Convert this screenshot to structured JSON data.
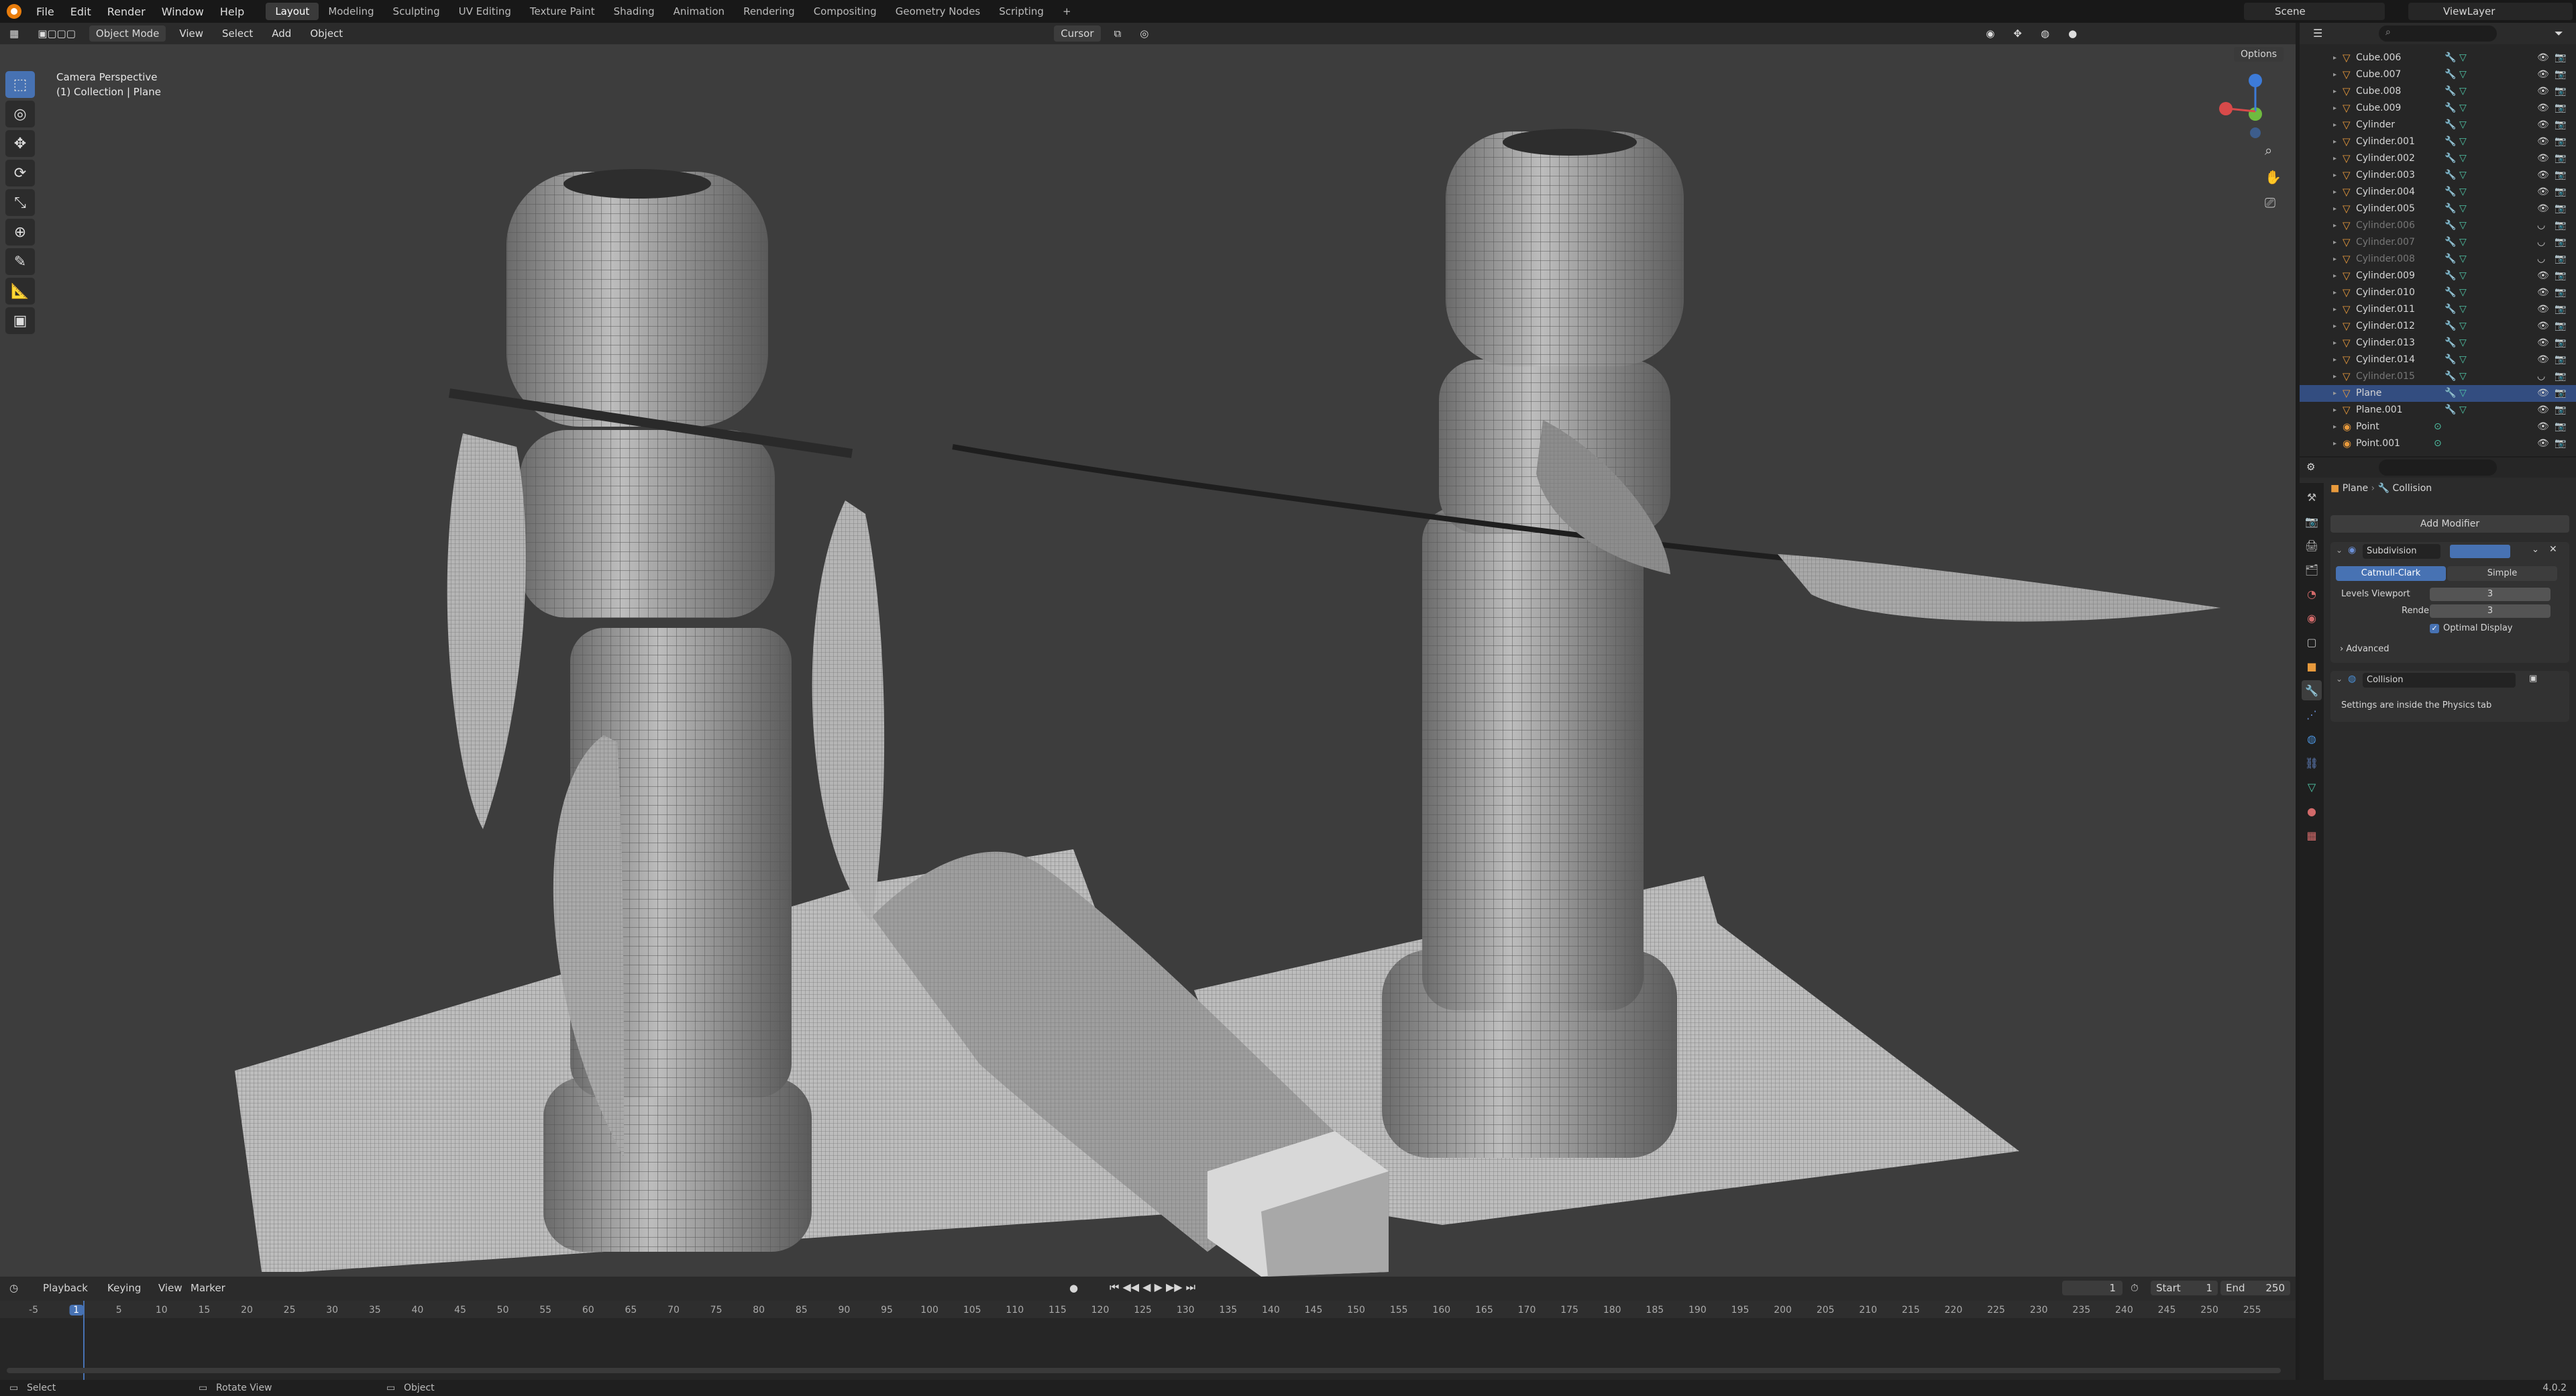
{
  "topbar": {
    "menus": [
      "File",
      "Edit",
      "Render",
      "Window",
      "Help"
    ],
    "workspaces": [
      "Layout",
      "Modeling",
      "Sculpting",
      "UV Editing",
      "Texture Paint",
      "Shading",
      "Animation",
      "Rendering",
      "Compositing",
      "Geometry Nodes",
      "Scripting",
      "+"
    ],
    "active_workspace": "Layout",
    "scene": "Scene",
    "view_layer": "ViewLayer"
  },
  "viewport_header": {
    "mode": "Object Mode",
    "menus": [
      "View",
      "Select",
      "Add",
      "Object"
    ],
    "transform_orientation": "Cursor",
    "options": "Options"
  },
  "viewport_info": {
    "line1": "Camera Perspective",
    "line2": "(1) Collection | Plane"
  },
  "outliner": {
    "rows": [
      {
        "name": "Cube.006",
        "state": "normal"
      },
      {
        "name": "Cube.007",
        "state": "normal"
      },
      {
        "name": "Cube.008",
        "state": "normal"
      },
      {
        "name": "Cube.009",
        "state": "normal"
      },
      {
        "name": "Cylinder",
        "state": "normal"
      },
      {
        "name": "Cylinder.001",
        "state": "normal"
      },
      {
        "name": "Cylinder.002",
        "state": "normal"
      },
      {
        "name": "Cylinder.003",
        "state": "normal"
      },
      {
        "name": "Cylinder.004",
        "state": "normal"
      },
      {
        "name": "Cylinder.005",
        "state": "normal"
      },
      {
        "name": "Cylinder.006",
        "state": "dim"
      },
      {
        "name": "Cylinder.007",
        "state": "dim"
      },
      {
        "name": "Cylinder.008",
        "state": "dim"
      },
      {
        "name": "Cylinder.009",
        "state": "normal"
      },
      {
        "name": "Cylinder.010",
        "state": "normal"
      },
      {
        "name": "Cylinder.011",
        "state": "normal"
      },
      {
        "name": "Cylinder.012",
        "state": "normal"
      },
      {
        "name": "Cylinder.013",
        "state": "normal"
      },
      {
        "name": "Cylinder.014",
        "state": "normal"
      },
      {
        "name": "Cylinder.015",
        "state": "dim"
      },
      {
        "name": "Plane",
        "state": "selected"
      },
      {
        "name": "Plane.001",
        "state": "normal"
      },
      {
        "name": "Point",
        "state": "light"
      },
      {
        "name": "Point.001",
        "state": "light"
      }
    ]
  },
  "properties": {
    "breadcrumb_object": "Plane",
    "breadcrumb_modifier": "Collision",
    "add_modifier": "Add Modifier",
    "subdivision": {
      "name": "Subdivision",
      "mode_a": "Catmull-Clark",
      "mode_b": "Simple",
      "levels_viewport_label": "Levels Viewport",
      "levels_viewport": "3",
      "render_label": "Render",
      "render": "3",
      "optimal_display": "Optimal Display",
      "advanced": "Advanced"
    },
    "collision": {
      "name": "Collision",
      "note": "Settings are inside the Physics tab"
    }
  },
  "timeline": {
    "menus": [
      "Playback",
      "Keying",
      "View",
      "Marker"
    ],
    "current_frame": "1",
    "start_label": "Start",
    "start": "1",
    "end_label": "End",
    "end": "250",
    "ticks": [
      "-5",
      "1",
      "5",
      "10",
      "15",
      "20",
      "25",
      "30",
      "35",
      "40",
      "45",
      "50",
      "55",
      "60",
      "65",
      "70",
      "75",
      "80",
      "85",
      "90",
      "95",
      "100",
      "105",
      "110",
      "115",
      "120",
      "125",
      "130",
      "135",
      "140",
      "145",
      "150",
      "155",
      "160",
      "165",
      "170",
      "175",
      "180",
      "185",
      "190",
      "195",
      "200",
      "205",
      "210",
      "215",
      "220",
      "225",
      "230",
      "235",
      "240",
      "245",
      "250",
      "255"
    ]
  },
  "status_bar": {
    "select": "Select",
    "rotate": "Rotate View",
    "object": "Object",
    "version": "4.0.2"
  }
}
